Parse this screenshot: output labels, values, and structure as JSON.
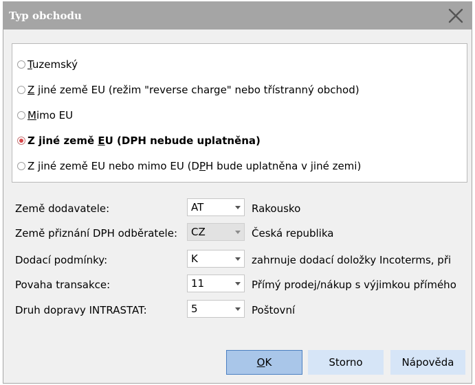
{
  "window": {
    "title": "Typ obchodu",
    "close_icon": "close-icon"
  },
  "radio_options": [
    {
      "key": "T",
      "rest": "uzemský",
      "pre": "",
      "selected": false
    },
    {
      "key": "Z",
      "rest": " jiné země EU (režim \"reverse charge\" nebo třístranný obchod)",
      "pre": "",
      "selected": false
    },
    {
      "key": "M",
      "rest": "imo EU",
      "pre": "",
      "selected": false
    },
    {
      "pre": "Z jiné země ",
      "key": "E",
      "rest": "U (DPH nebude uplatněna)",
      "selected": true
    },
    {
      "pre": "Z jiné země EU nebo mimo EU (D",
      "key": "P",
      "rest": "H bude uplatněna v jiné zemi)",
      "selected": false
    }
  ],
  "fields": [
    {
      "label": "Země dodavatele:",
      "value": "AT",
      "desc": "Rakousko",
      "disabled": false
    },
    {
      "label": "Země přiznání DPH odběratele:",
      "value": "CZ",
      "desc": "Česká republika",
      "disabled": true
    },
    {
      "label": "Dodací podmínky:",
      "value": "K",
      "desc": "zahrnuje dodací doložky Incoterms, při",
      "disabled": false
    },
    {
      "label": "Povaha transakce:",
      "value": "11",
      "desc": "Přímý prodej/nákup s výjimkou přímého",
      "disabled": false
    },
    {
      "label": "Druh dopravy INTRASTAT:",
      "value": "5",
      "desc": "Poštovní",
      "disabled": false
    }
  ],
  "buttons": {
    "ok_key": "O",
    "ok_rest": "K",
    "storno": "Storno",
    "help": "Nápověda"
  },
  "colors": {
    "titlebar": "#a5a5a5",
    "dialog_bg": "#f0f0f0",
    "ok_button": "#a9c6e9",
    "secondary_button": "#d6e5f7",
    "radio_selected": "#d8464a"
  }
}
